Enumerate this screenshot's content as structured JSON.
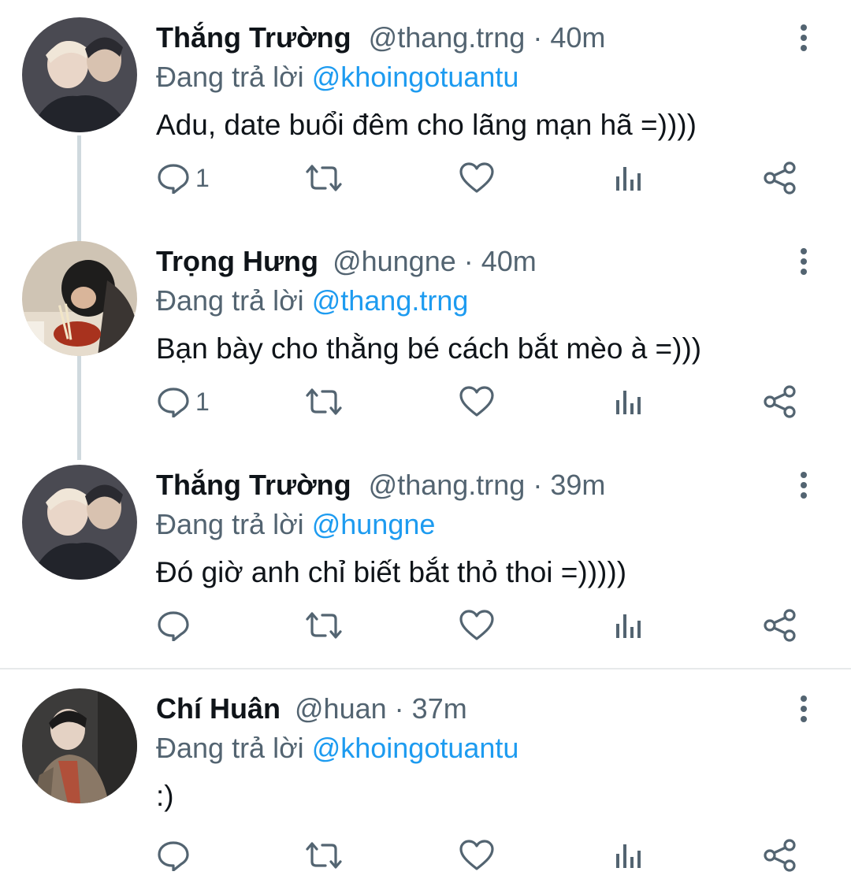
{
  "tweets": [
    {
      "name": "Thắng Trường",
      "handle": "@thang.trng",
      "dot": "·",
      "time": "40m",
      "reply_prefix": "Đang trả lời",
      "reply_to": "@khoingotuantu",
      "text": "Adu, date buổi đêm cho lãng mạn hã =))))",
      "reply_count": "1"
    },
    {
      "name": "Trọng Hưng",
      "handle": "@hungne",
      "dot": "·",
      "time": "40m",
      "reply_prefix": "Đang trả lời",
      "reply_to": "@thang.trng",
      "text": "Bạn bày cho thằng bé cách bắt mèo à =)))",
      "reply_count": "1"
    },
    {
      "name": "Thắng Trường",
      "handle": "@thang.trng",
      "dot": "·",
      "time": "39m",
      "reply_prefix": "Đang trả lời",
      "reply_to": "@hungne",
      "text": "Đó giờ anh chỉ biết bắt thỏ thoi =)))))",
      "reply_count": ""
    },
    {
      "name": "Chí Huân",
      "handle": "@huan",
      "dot": "·",
      "time": "37m",
      "reply_prefix": "Đang trả lời",
      "reply_to": "@khoingotuantu",
      "text": ":)",
      "reply_count": ""
    }
  ],
  "icons": [
    "reply-icon",
    "retweet-icon",
    "like-icon",
    "views-icon",
    "share-icon",
    "more-options-icon"
  ],
  "colors": {
    "text": "#0f1419",
    "secondary": "#536471",
    "mention": "#1d9bf0",
    "thread_line": "#cfd9de",
    "divider": "#e7e9ea"
  }
}
